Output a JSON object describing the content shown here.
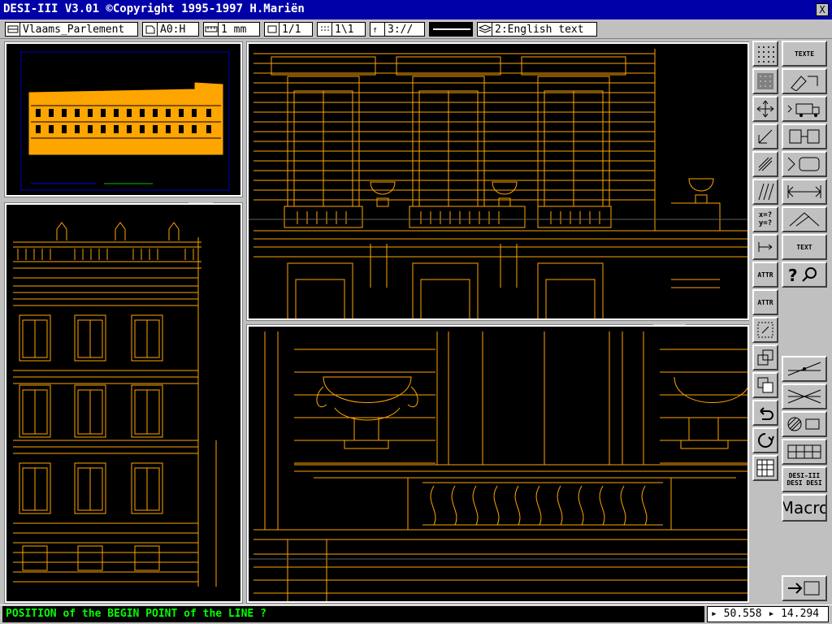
{
  "window": {
    "title": "DESI-III V3.01  ©Copyright 1995-1997 H.Mariën",
    "close_label": "X"
  },
  "toolbar": {
    "drawing_name": "Vlaams_Parlement",
    "paper_format": "A0:H",
    "unit": "1 mm",
    "scale": "1/1",
    "snap": "1\\1",
    "font": "3://",
    "language": "2:English text"
  },
  "palette": {
    "buttons": [
      "TEXTE",
      "DESI-III",
      "DESI",
      "DESI",
      "TEXT",
      "TEXT",
      "ATTR",
      "ATTR",
      "x=?",
      "y=?"
    ],
    "macro_label": "Macro"
  },
  "status": {
    "prompt": "POSITION of the BEGIN POINT of the LINE ?",
    "x_coord": "50.558",
    "y_coord": "14.294"
  },
  "colors": {
    "drawing_lines": "#ffa500",
    "background": "#000000",
    "titlebar": "#0000a8",
    "prompt_text": "#00ff00"
  }
}
